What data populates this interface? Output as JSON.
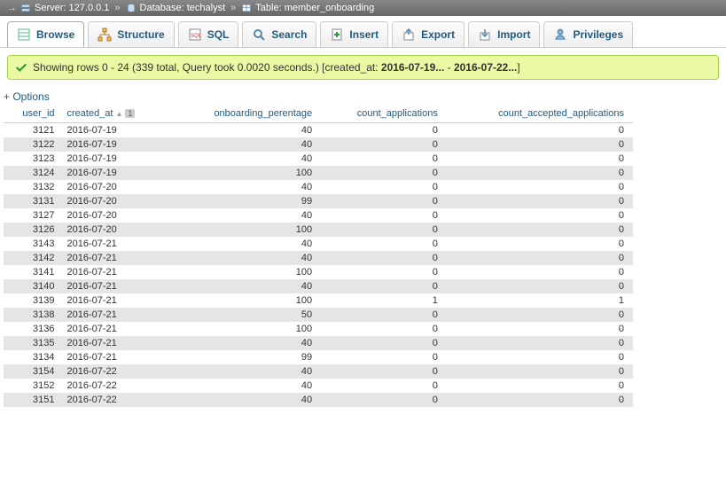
{
  "breadcrumb": {
    "server_label": "Server:",
    "server": "127.0.0.1",
    "db_label": "Database:",
    "db": "techalyst",
    "table_label": "Table:",
    "table": "member_onboarding",
    "arrow": "→"
  },
  "tabs": [
    {
      "key": "browse",
      "label": "Browse"
    },
    {
      "key": "structure",
      "label": "Structure"
    },
    {
      "key": "sql",
      "label": "SQL"
    },
    {
      "key": "search",
      "label": "Search"
    },
    {
      "key": "insert",
      "label": "Insert"
    },
    {
      "key": "export",
      "label": "Export"
    },
    {
      "key": "import",
      "label": "Import"
    },
    {
      "key": "privileges",
      "label": "Privileges"
    }
  ],
  "message": {
    "before": "Showing rows 0 - 24 (339 total, Query took 0.0020 seconds.) [created_at: ",
    "b1": "2016-07-19...",
    "mid": " - ",
    "b2": "2016-07-22...",
    "after": "]"
  },
  "options_link": "+ Options",
  "columns": [
    "user_id",
    "created_at",
    "onboarding_perentage",
    "count_applications",
    "count_accepted_applications"
  ],
  "sort": {
    "col": 1,
    "dir": "asc",
    "index": "1"
  },
  "rows": [
    {
      "user_id": 3121,
      "created_at": "2016-07-19",
      "onboarding_perentage": 40,
      "count_applications": 0,
      "count_accepted_applications": 0
    },
    {
      "user_id": 3122,
      "created_at": "2016-07-19",
      "onboarding_perentage": 40,
      "count_applications": 0,
      "count_accepted_applications": 0
    },
    {
      "user_id": 3123,
      "created_at": "2016-07-19",
      "onboarding_perentage": 40,
      "count_applications": 0,
      "count_accepted_applications": 0
    },
    {
      "user_id": 3124,
      "created_at": "2016-07-19",
      "onboarding_perentage": 100,
      "count_applications": 0,
      "count_accepted_applications": 0
    },
    {
      "user_id": 3132,
      "created_at": "2016-07-20",
      "onboarding_perentage": 40,
      "count_applications": 0,
      "count_accepted_applications": 0
    },
    {
      "user_id": 3131,
      "created_at": "2016-07-20",
      "onboarding_perentage": 99,
      "count_applications": 0,
      "count_accepted_applications": 0
    },
    {
      "user_id": 3127,
      "created_at": "2016-07-20",
      "onboarding_perentage": 40,
      "count_applications": 0,
      "count_accepted_applications": 0
    },
    {
      "user_id": 3126,
      "created_at": "2016-07-20",
      "onboarding_perentage": 100,
      "count_applications": 0,
      "count_accepted_applications": 0
    },
    {
      "user_id": 3143,
      "created_at": "2016-07-21",
      "onboarding_perentage": 40,
      "count_applications": 0,
      "count_accepted_applications": 0
    },
    {
      "user_id": 3142,
      "created_at": "2016-07-21",
      "onboarding_perentage": 40,
      "count_applications": 0,
      "count_accepted_applications": 0
    },
    {
      "user_id": 3141,
      "created_at": "2016-07-21",
      "onboarding_perentage": 100,
      "count_applications": 0,
      "count_accepted_applications": 0
    },
    {
      "user_id": 3140,
      "created_at": "2016-07-21",
      "onboarding_perentage": 40,
      "count_applications": 0,
      "count_accepted_applications": 0
    },
    {
      "user_id": 3139,
      "created_at": "2016-07-21",
      "onboarding_perentage": 100,
      "count_applications": 1,
      "count_accepted_applications": 1
    },
    {
      "user_id": 3138,
      "created_at": "2016-07-21",
      "onboarding_perentage": 50,
      "count_applications": 0,
      "count_accepted_applications": 0
    },
    {
      "user_id": 3136,
      "created_at": "2016-07-21",
      "onboarding_perentage": 100,
      "count_applications": 0,
      "count_accepted_applications": 0
    },
    {
      "user_id": 3135,
      "created_at": "2016-07-21",
      "onboarding_perentage": 40,
      "count_applications": 0,
      "count_accepted_applications": 0
    },
    {
      "user_id": 3134,
      "created_at": "2016-07-21",
      "onboarding_perentage": 99,
      "count_applications": 0,
      "count_accepted_applications": 0
    },
    {
      "user_id": 3154,
      "created_at": "2016-07-22",
      "onboarding_perentage": 40,
      "count_applications": 0,
      "count_accepted_applications": 0
    },
    {
      "user_id": 3152,
      "created_at": "2016-07-22",
      "onboarding_perentage": 40,
      "count_applications": 0,
      "count_accepted_applications": 0
    },
    {
      "user_id": 3151,
      "created_at": "2016-07-22",
      "onboarding_perentage": 40,
      "count_applications": 0,
      "count_accepted_applications": 0
    }
  ]
}
